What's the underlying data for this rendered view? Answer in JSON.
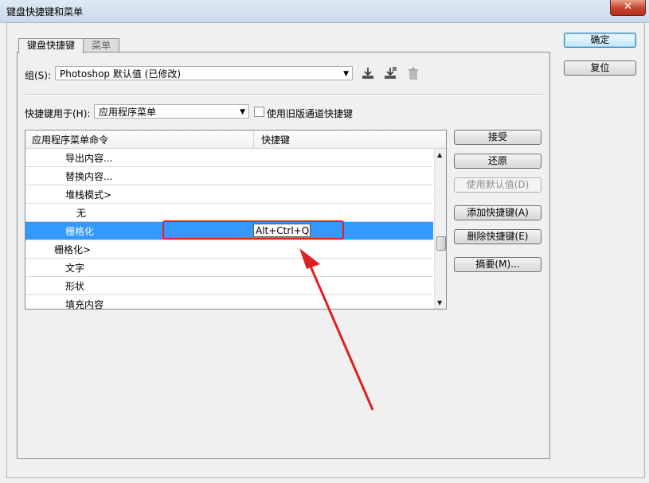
{
  "window": {
    "title": "键盘快捷键和菜单",
    "close_glyph": "✕"
  },
  "buttons": {
    "ok": "确定",
    "reset": "复位",
    "accept": "接受",
    "undo": "还原",
    "use_default": "使用默认值(D)",
    "add_shortcut": "添加快捷键(A)",
    "delete_shortcut": "删除快捷键(E)",
    "summarize": "摘要(M)..."
  },
  "tabs": [
    "键盘快捷键",
    "菜单"
  ],
  "set_label": "组(S):",
  "set_value": "Photoshop 默认值 (已修改)",
  "shortcuts_for_label": "快捷键用于(H):",
  "shortcuts_for_value": "应用程序菜单",
  "legacy_checkbox_label": "使用旧版通道快捷键",
  "legacy_checked": false,
  "table": {
    "headers": [
      "应用程序菜单命令",
      "快捷键"
    ],
    "rows": [
      {
        "command": "导出内容...",
        "shortcut": "",
        "selected": false
      },
      {
        "command": "替换内容...",
        "shortcut": "",
        "selected": false
      },
      {
        "command": "堆栈模式>",
        "shortcut": "",
        "selected": false
      },
      {
        "command": "无",
        "shortcut": "",
        "selected": false
      },
      {
        "command": "栅格化",
        "shortcut": "Alt+Ctrl+Q",
        "selected": true
      },
      {
        "command": "栅格化>",
        "shortcut": "",
        "selected": false
      },
      {
        "command": "文字",
        "shortcut": "",
        "selected": false
      },
      {
        "command": "形状",
        "shortcut": "",
        "selected": false
      },
      {
        "command": "填充内容",
        "shortcut": "",
        "selected": false
      }
    ]
  },
  "icons": {
    "save_set": "save-set-icon",
    "save_as": "save-set-as-icon",
    "delete_set": "trash-icon"
  },
  "colors": {
    "selection": "#3399ff",
    "annotation": "#e02020"
  }
}
